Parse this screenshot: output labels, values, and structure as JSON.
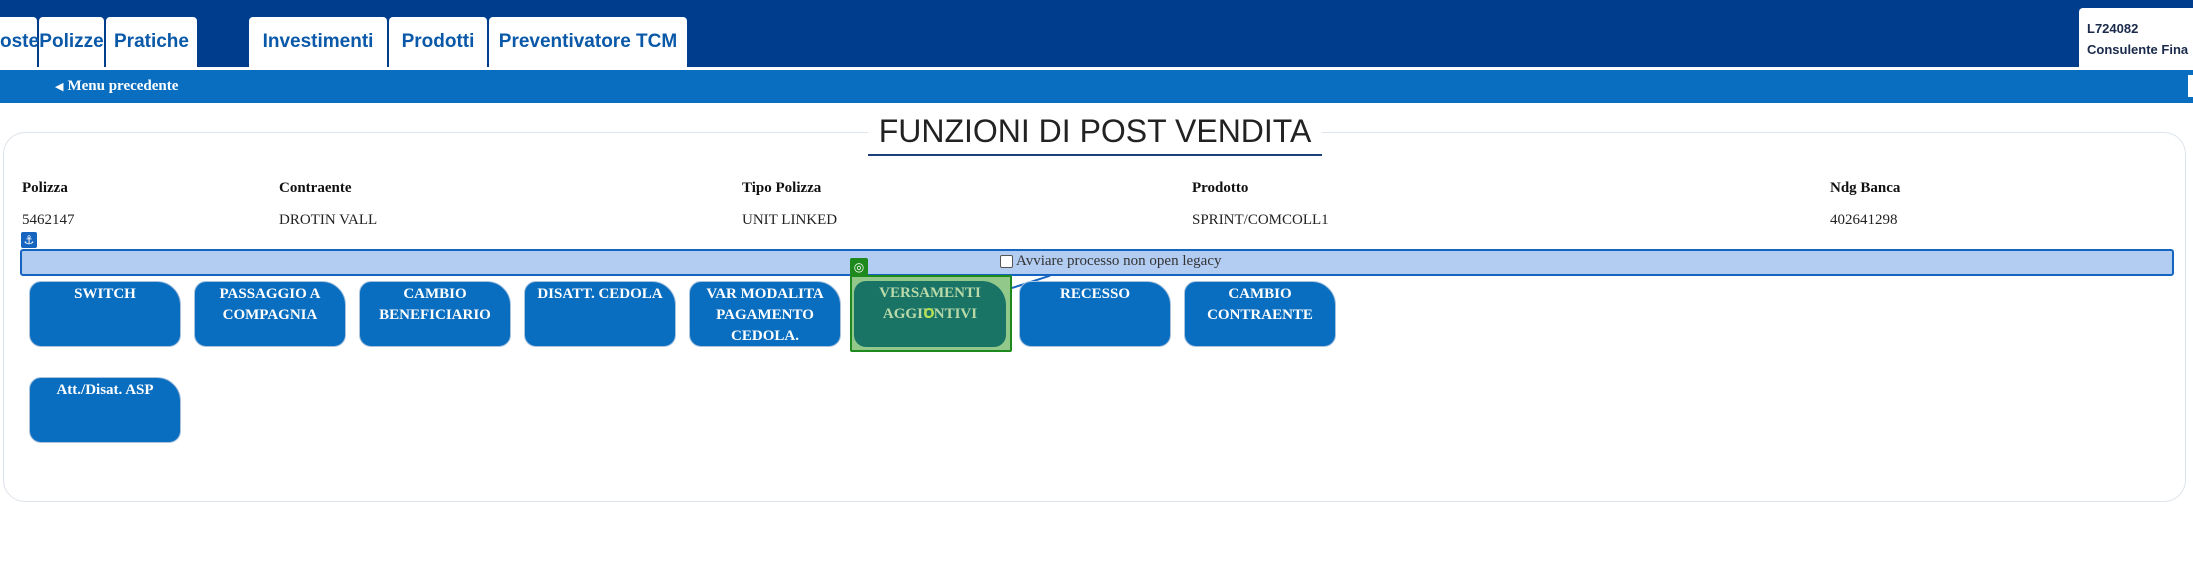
{
  "nav": {
    "tabs": [
      "oste",
      "Polizze",
      "Pratiche",
      "Investimenti",
      "Prodotti",
      "Preventivatore TCM"
    ],
    "user_code": "L724082",
    "user_role": "Consulente Fina"
  },
  "subbar": {
    "back_label": "Menu precedente"
  },
  "page": {
    "title": "FUNZIONI DI POST VENDITA"
  },
  "policy_info": {
    "headers": [
      "Polizza",
      "Contraente",
      "Tipo Polizza",
      "Prodotto",
      "Ndg Banca"
    ],
    "values": [
      "5462147",
      "DROTIN VALL",
      "UNIT LINKED",
      "SPRINT/COMCOLL1",
      "402641298"
    ]
  },
  "legacy": {
    "label": "Avviare processo non open legacy",
    "checked": false
  },
  "actions": {
    "row1": [
      "SWITCH",
      "PASSAGGIO A COMPAGNIA",
      "CAMBIO BENEFICIARIO",
      "DISATT. CEDOLA",
      "VAR MODALITA PAGAMENTO CEDOLA.",
      "VERSAMENTI AGGIUNTIVI",
      "RECESSO",
      "CAMBIO CONTRAENTE"
    ],
    "row2": [
      "Att./Disat. ASP"
    ],
    "selected": "VERSAMENTI AGGIUNTIVI"
  },
  "colors": {
    "nav_bg": "#003d8c",
    "subbar_bg": "#0a6ec0",
    "button_bg": "#0a6ec0",
    "selected_highlight": "#1e8a1e",
    "legacy_bar_bg": "#b3cdf2"
  },
  "icons": {
    "back": "chevron-left-icon",
    "anchor": "anchor-icon",
    "target": "target-icon"
  }
}
